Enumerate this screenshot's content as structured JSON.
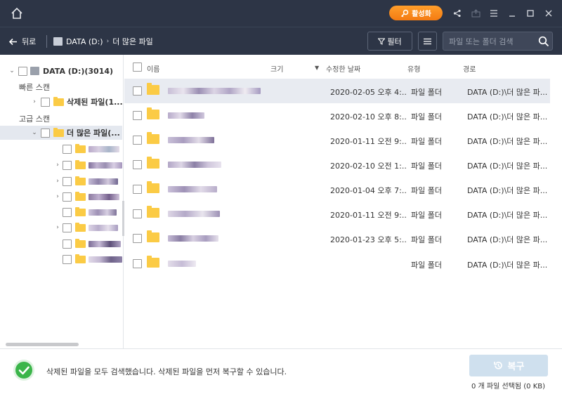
{
  "titlebar": {
    "activate_label": "활성화"
  },
  "toolbar": {
    "back_label": "뒤로",
    "breadcrumb": [
      "DATA (D:)",
      "더 많은 파일"
    ],
    "filter_label": "필터",
    "search_placeholder": "파일 또는 폴더 검색"
  },
  "sidebar": {
    "drive_label": "DATA (D:)(3014)",
    "quick_scan_label": "빠른 스캔",
    "deleted_files_label": "삭제된 파일(1...",
    "advanced_scan_label": "고급 스캔",
    "more_files_label": "더 많은 파일(..."
  },
  "table": {
    "headers": {
      "name": "이름",
      "size": "크기",
      "modified": "수정한 날짜",
      "type": "유형",
      "path": "경로"
    },
    "rows": [
      {
        "date": "2020-02-05 오후 4:...",
        "type": "파일 폴더",
        "path": "DATA (D:)\\더 많은 파..."
      },
      {
        "date": "2020-02-10 오후 8:...",
        "type": "파일 폴더",
        "path": "DATA (D:)\\더 많은 파..."
      },
      {
        "date": "2020-01-11 오전 9:...",
        "type": "파일 폴더",
        "path": "DATA (D:)\\더 많은 파..."
      },
      {
        "date": "2020-02-10 오전 1:...",
        "type": "파일 폴더",
        "path": "DATA (D:)\\더 많은 파..."
      },
      {
        "date": "2020-01-04 오후 7:...",
        "type": "파일 폴더",
        "path": "DATA (D:)\\더 많은 파..."
      },
      {
        "date": "2020-01-11 오전 9:...",
        "type": "파일 폴더",
        "path": "DATA (D:)\\더 많은 파..."
      },
      {
        "date": "2020-01-23 오후 5:...",
        "type": "파일 폴더",
        "path": "DATA (D:)\\더 많은 파..."
      },
      {
        "date": "",
        "type": "파일 폴더",
        "path": "DATA (D:)\\더 많은 파..."
      }
    ]
  },
  "footer": {
    "message": "삭제된 파일을 모두 검색했습니다. 삭제된 파일을 먼저 복구할 수 있습니다.",
    "recover_label": "복구",
    "selected_count": "0 개 파일 선택됨 (0 KB)"
  },
  "colors": {
    "header_bg": "#2d3546",
    "accent_orange": "#f47b12",
    "folder_yellow": "#fbcb45",
    "success_green": "#3bb54a",
    "recover_disabled": "#cfe0ee"
  }
}
